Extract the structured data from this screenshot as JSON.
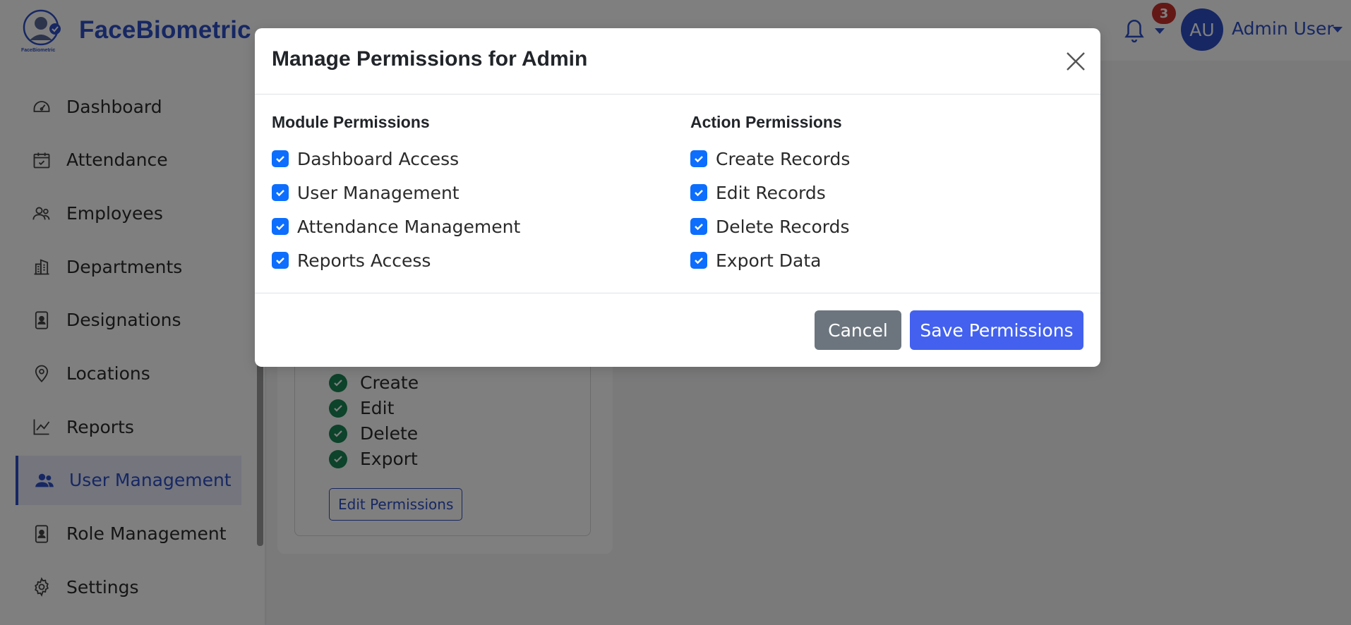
{
  "brand": {
    "name": "FaceBiometric",
    "logo_caption": "FaceBiometric"
  },
  "sidebar": {
    "items": [
      {
        "label": "Dashboard",
        "icon": "speedometer-icon"
      },
      {
        "label": "Attendance",
        "icon": "calendar-check-icon"
      },
      {
        "label": "Employees",
        "icon": "people-icon"
      },
      {
        "label": "Departments",
        "icon": "building-icon"
      },
      {
        "label": "Designations",
        "icon": "badge-icon"
      },
      {
        "label": "Locations",
        "icon": "map-pin-icon"
      },
      {
        "label": "Reports",
        "icon": "line-chart-icon"
      },
      {
        "label": "User Management",
        "icon": "users-icon",
        "active": true
      },
      {
        "label": "Role Management",
        "icon": "id-card-icon"
      },
      {
        "label": "Settings",
        "icon": "gear-icon"
      }
    ]
  },
  "header": {
    "notification_count": "3",
    "avatar_initials": "AU",
    "user_name": "Admin User"
  },
  "background_card": {
    "permissions": [
      "Create",
      "Edit",
      "Delete",
      "Export"
    ],
    "edit_button": "Edit Permissions"
  },
  "modal": {
    "title": "Manage Permissions for Admin",
    "module_permissions": {
      "title": "Module Permissions",
      "items": [
        {
          "label": "Dashboard Access",
          "checked": true
        },
        {
          "label": "User Management",
          "checked": true
        },
        {
          "label": "Attendance Management",
          "checked": true
        },
        {
          "label": "Reports Access",
          "checked": true
        }
      ]
    },
    "action_permissions": {
      "title": "Action Permissions",
      "items": [
        {
          "label": "Create Records",
          "checked": true
        },
        {
          "label": "Edit Records",
          "checked": true
        },
        {
          "label": "Delete Records",
          "checked": true
        },
        {
          "label": "Export Data",
          "checked": true
        }
      ]
    },
    "cancel_label": "Cancel",
    "save_label": "Save Permissions"
  },
  "colors": {
    "brand": "#2d4fc7",
    "checkbox": "#0d6efd",
    "save": "#4361ee",
    "cancel": "#6c757d",
    "badge": "#c9302c",
    "success": "#198754"
  }
}
